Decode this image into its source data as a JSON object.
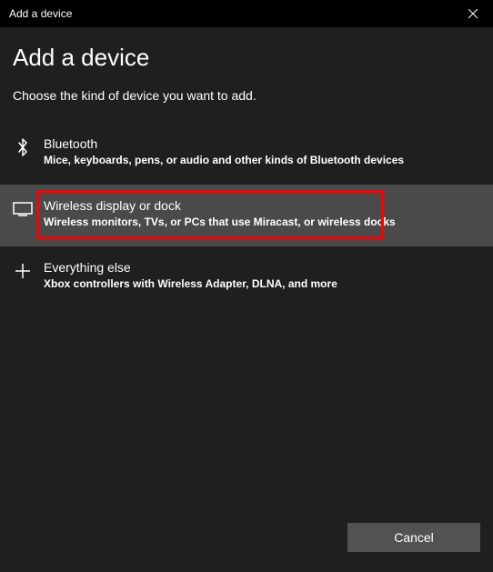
{
  "titlebar": {
    "title": "Add a device"
  },
  "header": {
    "page_title": "Add a device",
    "subtitle": "Choose the kind of device you want to add."
  },
  "options": [
    {
      "icon": "bluetooth",
      "title": "Bluetooth",
      "desc": "Mice, keyboards, pens, or audio and other kinds of Bluetooth devices",
      "highlighted": false,
      "annotated": false
    },
    {
      "icon": "display",
      "title": "Wireless display or dock",
      "desc": "Wireless monitors, TVs, or PCs that use Miracast, or wireless docks",
      "highlighted": true,
      "annotated": true
    },
    {
      "icon": "plus",
      "title": "Everything else",
      "desc": "Xbox controllers with Wireless Adapter, DLNA, and more",
      "highlighted": false,
      "annotated": false
    }
  ],
  "footer": {
    "cancel_label": "Cancel"
  }
}
